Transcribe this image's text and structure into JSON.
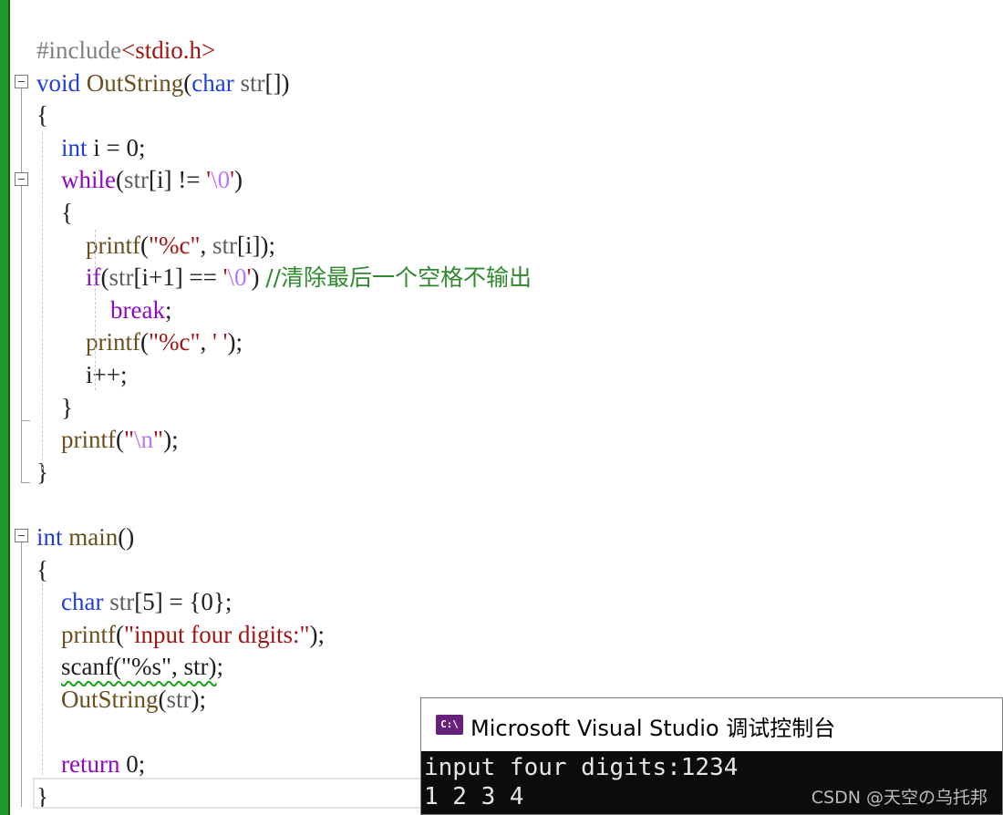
{
  "editor": {
    "lines": [
      {
        "id": "L1",
        "tokens": [
          {
            "t": "#include",
            "c": "pp"
          },
          {
            "t": "<stdio.h>",
            "c": "inc"
          }
        ]
      },
      {
        "id": "L2",
        "tokens": [
          {
            "t": "void",
            "c": "kw"
          },
          {
            "t": " OutString",
            "c": "fn"
          },
          {
            "t": "(",
            "c": ""
          },
          {
            "t": "char",
            "c": "kw"
          },
          {
            "t": " str",
            "c": "var"
          },
          {
            "t": "[])",
            "c": ""
          }
        ]
      },
      {
        "id": "L3",
        "tokens": [
          {
            "t": "{",
            "c": ""
          }
        ]
      },
      {
        "id": "L4",
        "tokens": [
          {
            "t": "    ",
            "c": ""
          },
          {
            "t": "int",
            "c": "kw"
          },
          {
            "t": " i = 0;",
            "c": ""
          }
        ]
      },
      {
        "id": "L5",
        "tokens": [
          {
            "t": "    ",
            "c": ""
          },
          {
            "t": "while",
            "c": "flow"
          },
          {
            "t": "(",
            "c": ""
          },
          {
            "t": "str",
            "c": "var"
          },
          {
            "t": "[i] != ",
            "c": ""
          },
          {
            "t": "'",
            "c": "str"
          },
          {
            "t": "\\0",
            "c": "esc"
          },
          {
            "t": "'",
            "c": "str"
          },
          {
            "t": ")",
            "c": ""
          }
        ]
      },
      {
        "id": "L6",
        "tokens": [
          {
            "t": "    {",
            "c": ""
          }
        ]
      },
      {
        "id": "L7",
        "tokens": [
          {
            "t": "        ",
            "c": ""
          },
          {
            "t": "printf",
            "c": "fn"
          },
          {
            "t": "(",
            "c": ""
          },
          {
            "t": "\"%c\"",
            "c": "str"
          },
          {
            "t": ", ",
            "c": ""
          },
          {
            "t": "str",
            "c": "var"
          },
          {
            "t": "[i]);",
            "c": ""
          }
        ]
      },
      {
        "id": "L8",
        "tokens": [
          {
            "t": "        ",
            "c": ""
          },
          {
            "t": "if",
            "c": "flow"
          },
          {
            "t": "(",
            "c": ""
          },
          {
            "t": "str",
            "c": "var"
          },
          {
            "t": "[i+1] == ",
            "c": ""
          },
          {
            "t": "'",
            "c": "str"
          },
          {
            "t": "\\0",
            "c": "esc"
          },
          {
            "t": "'",
            "c": "str"
          },
          {
            "t": ") ",
            "c": ""
          },
          {
            "t": "//清除最后一个空格不输出",
            "c": "cmt"
          }
        ]
      },
      {
        "id": "L9",
        "tokens": [
          {
            "t": "            ",
            "c": ""
          },
          {
            "t": "break",
            "c": "flow"
          },
          {
            "t": ";",
            "c": ""
          }
        ]
      },
      {
        "id": "L10",
        "tokens": [
          {
            "t": "        ",
            "c": ""
          },
          {
            "t": "printf",
            "c": "fn"
          },
          {
            "t": "(",
            "c": ""
          },
          {
            "t": "\"%c\"",
            "c": "str"
          },
          {
            "t": ", ",
            "c": ""
          },
          {
            "t": "' '",
            "c": "str"
          },
          {
            "t": ");",
            "c": ""
          }
        ]
      },
      {
        "id": "L11",
        "tokens": [
          {
            "t": "        i++;",
            "c": ""
          }
        ]
      },
      {
        "id": "L12",
        "tokens": [
          {
            "t": "    }",
            "c": ""
          }
        ]
      },
      {
        "id": "L13",
        "tokens": [
          {
            "t": "    ",
            "c": ""
          },
          {
            "t": "printf",
            "c": "fn"
          },
          {
            "t": "(",
            "c": ""
          },
          {
            "t": "\"",
            "c": "str"
          },
          {
            "t": "\\n",
            "c": "esc"
          },
          {
            "t": "\"",
            "c": "str"
          },
          {
            "t": ");",
            "c": ""
          }
        ]
      },
      {
        "id": "L14",
        "tokens": [
          {
            "t": "}",
            "c": ""
          }
        ]
      },
      {
        "id": "L15",
        "tokens": []
      },
      {
        "id": "L16",
        "tokens": [
          {
            "t": "int",
            "c": "kw"
          },
          {
            "t": " main",
            "c": "fn"
          },
          {
            "t": "()",
            "c": ""
          }
        ]
      },
      {
        "id": "L17",
        "tokens": [
          {
            "t": "{",
            "c": ""
          }
        ]
      },
      {
        "id": "L18",
        "tokens": [
          {
            "t": "    ",
            "c": ""
          },
          {
            "t": "char",
            "c": "kw"
          },
          {
            "t": " str",
            "c": "var"
          },
          {
            "t": "[5] = {0};",
            "c": ""
          }
        ]
      },
      {
        "id": "L19",
        "tokens": [
          {
            "t": "    ",
            "c": ""
          },
          {
            "t": "printf",
            "c": "fn"
          },
          {
            "t": "(",
            "c": ""
          },
          {
            "t": "\"input four digits:\"",
            "c": "str"
          },
          {
            "t": ");",
            "c": ""
          }
        ]
      },
      {
        "id": "L20",
        "tokens": [
          {
            "t": "    ",
            "c": ""
          },
          {
            "t": "scanf(\"%s\", str)",
            "c": "squiggle"
          },
          {
            "t": ";",
            "c": ""
          }
        ]
      },
      {
        "id": "L21",
        "tokens": [
          {
            "t": "    ",
            "c": ""
          },
          {
            "t": "OutString",
            "c": "fn"
          },
          {
            "t": "(",
            "c": ""
          },
          {
            "t": "str",
            "c": "var"
          },
          {
            "t": ");",
            "c": ""
          }
        ]
      },
      {
        "id": "L22",
        "tokens": []
      },
      {
        "id": "L23",
        "tokens": [
          {
            "t": "    ",
            "c": ""
          },
          {
            "t": "return",
            "c": "flow"
          },
          {
            "t": " 0;",
            "c": ""
          }
        ]
      },
      {
        "id": "L24",
        "tokens": [
          {
            "t": "}",
            "c": ""
          }
        ]
      }
    ]
  },
  "console": {
    "icon_label": "C:\\",
    "title": "Microsoft Visual Studio 调试控制台",
    "output": [
      "input four digits:1234",
      "1 2 3 4"
    ]
  },
  "watermark": "CSDN @天空の乌托邦",
  "colors": {
    "keyword": "#1f3fd6",
    "control_flow": "#8f08c4",
    "function": "#6b4f1d",
    "string": "#a31515",
    "escape": "#b776fb",
    "comment": "#2f8a2f",
    "gutter": "#1f9a28",
    "console_bg": "#0c0c0c"
  }
}
